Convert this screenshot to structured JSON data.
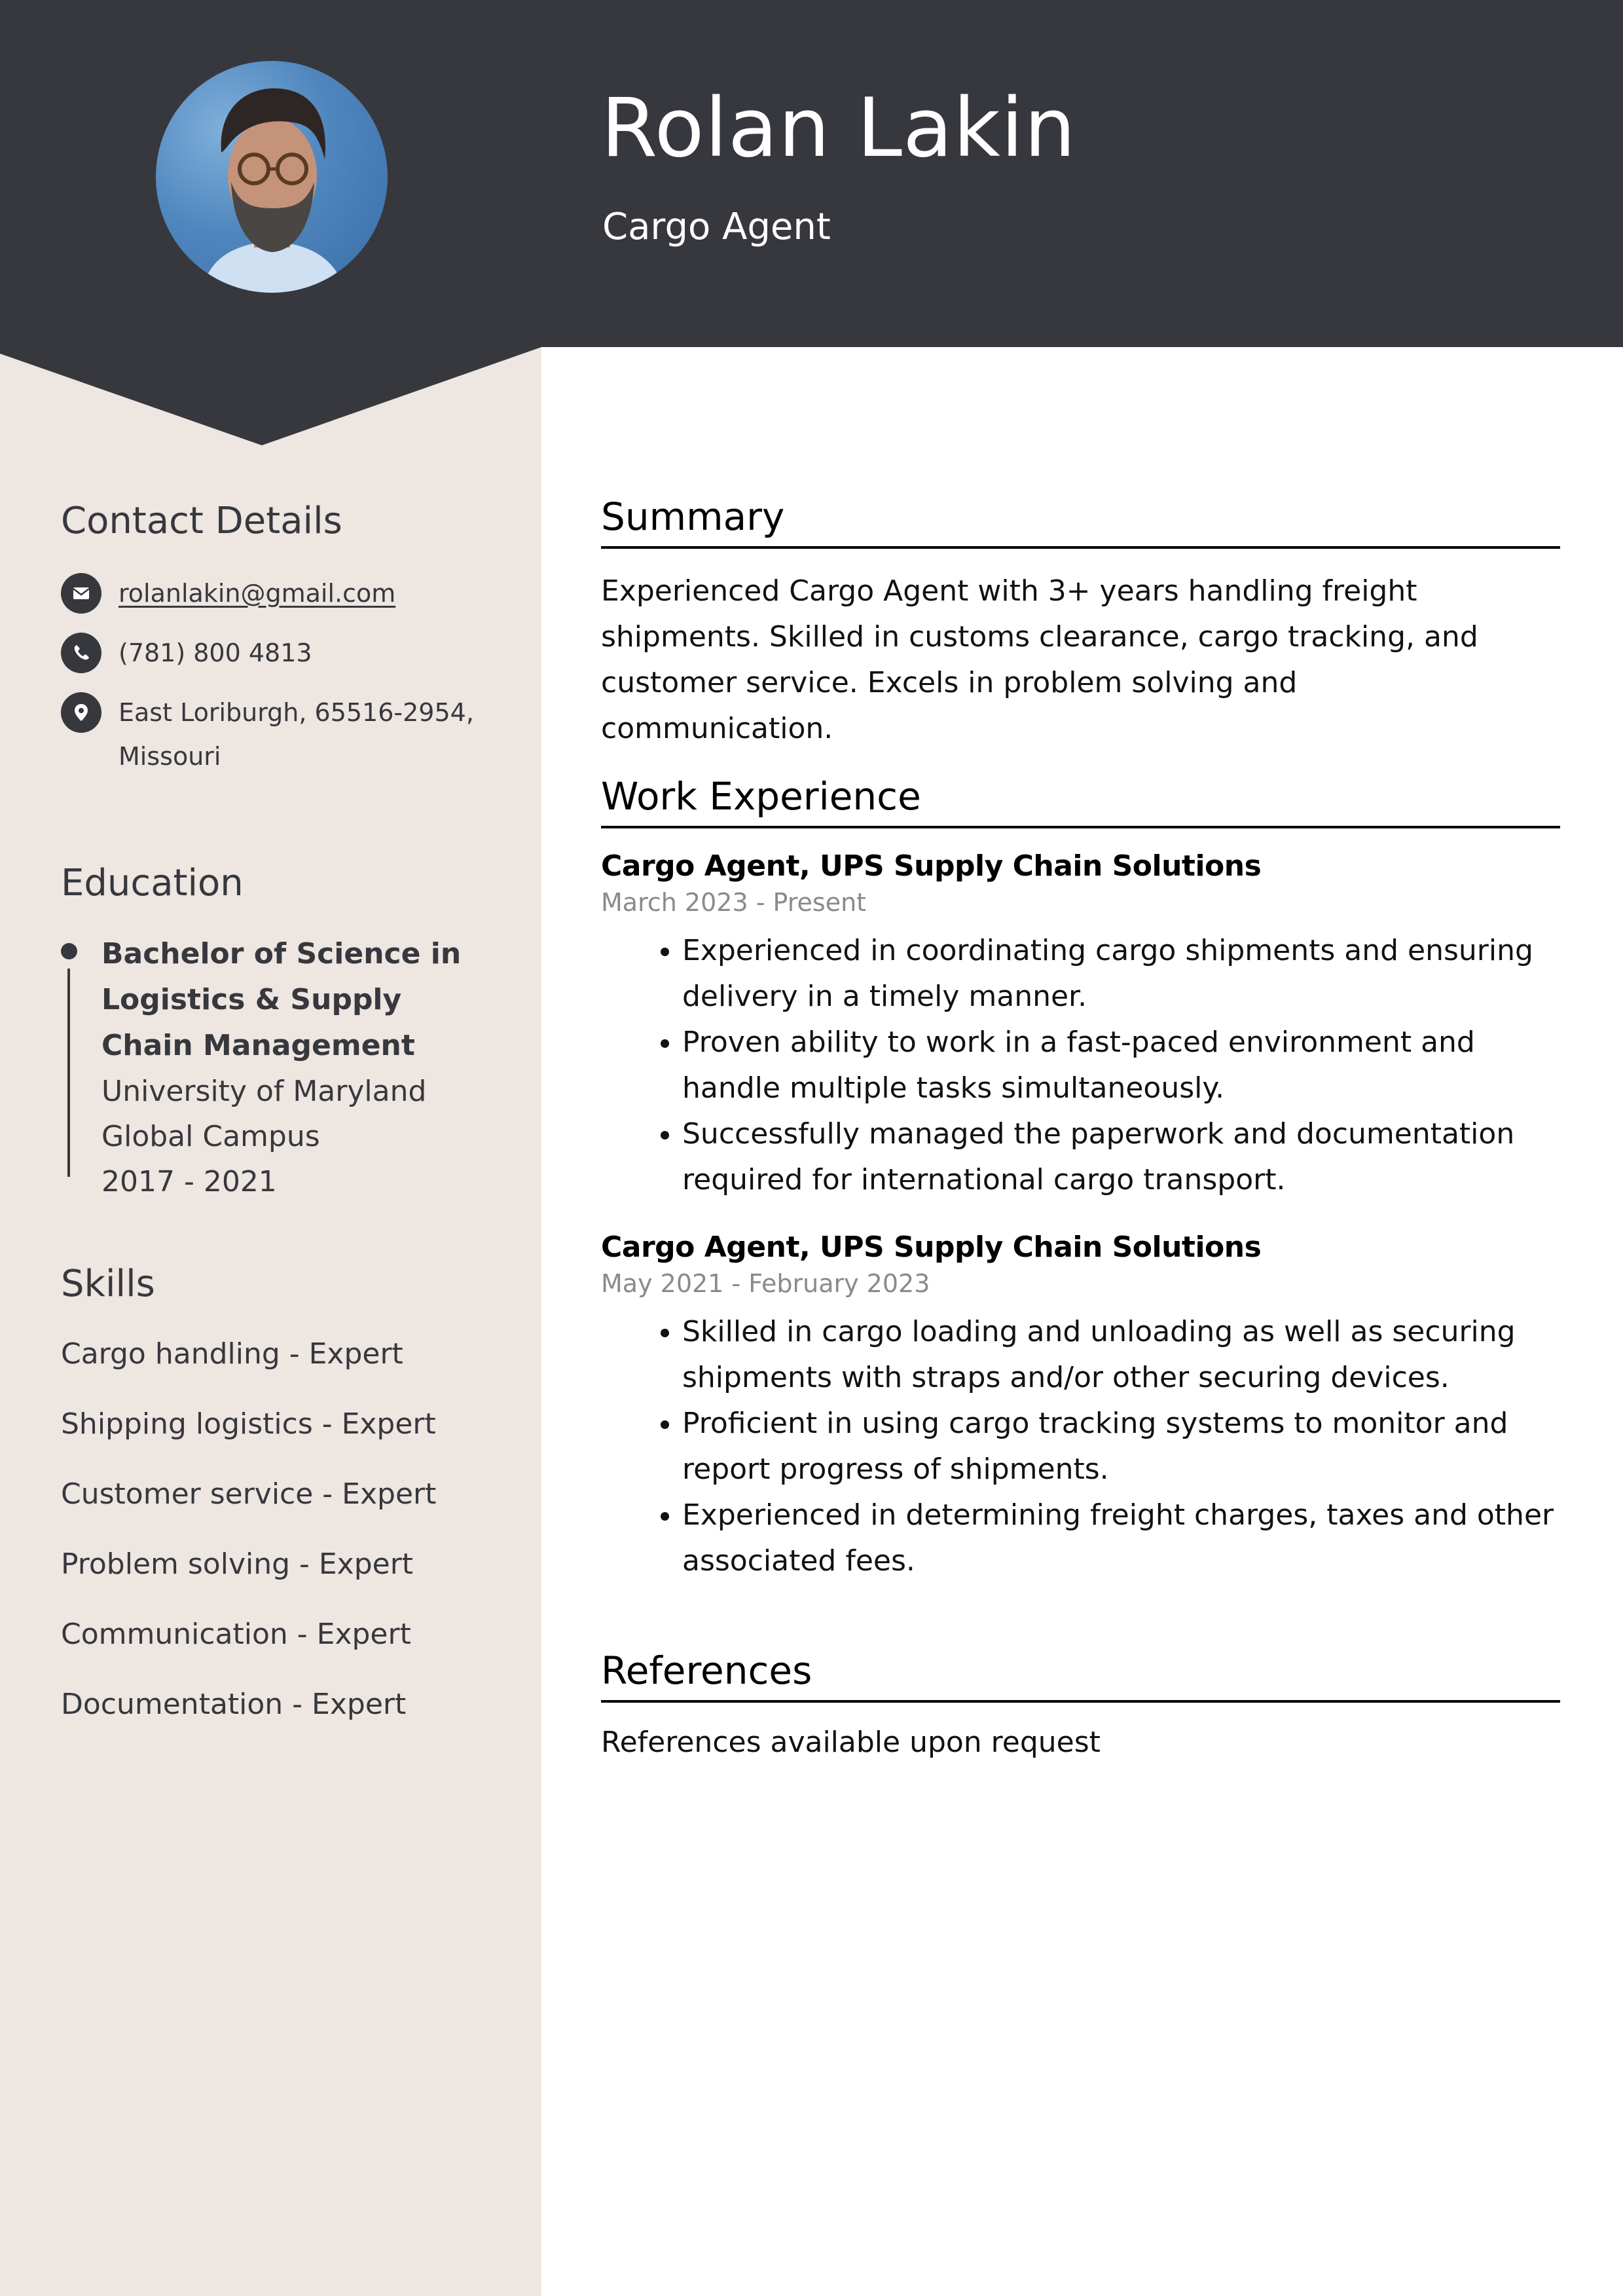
{
  "header": {
    "name": "Rolan Lakin",
    "title": "Cargo Agent",
    "photo_icon": "profile-photo"
  },
  "colors": {
    "header_bg": "#37383e",
    "sidebar_bg": "#ede6e1",
    "text_dark": "#37383e",
    "date_gray": "#8a8a8a"
  },
  "sidebar": {
    "contact": {
      "heading": "Contact Details",
      "email": "rolanlakin@gmail.com",
      "email_icon": "envelope-icon",
      "phone": "(781) 800 4813",
      "phone_icon": "phone-icon",
      "address_line1": "East Loriburgh, 65516-2954,",
      "address_line2": "Missouri",
      "address_icon": "map-pin-icon"
    },
    "education": {
      "heading": "Education",
      "items": [
        {
          "degree": "Bachelor of Science in Logistics & Supply Chain Management",
          "school": "University of Maryland Global Campus",
          "years": "2017 - 2021"
        }
      ]
    },
    "skills": {
      "heading": "Skills",
      "items": [
        "Cargo handling - Expert",
        "Shipping logistics - Expert",
        "Customer service - Expert",
        "Problem solving - Expert",
        "Communication - Expert",
        "Documentation - Expert"
      ]
    }
  },
  "main": {
    "summary": {
      "heading": "Summary",
      "text": "Experienced Cargo Agent with 3+ years handling freight shipments. Skilled in customs clearance, cargo tracking, and customer service. Excels in problem solving and communication."
    },
    "work": {
      "heading": "Work Experience",
      "jobs": [
        {
          "title": "Cargo Agent, UPS Supply Chain Solutions",
          "dates": "March 2023 - Present",
          "bullets": [
            "Experienced in coordinating cargo shipments and ensuring delivery in a timely manner.",
            "Proven ability to work in a fast-paced environment and handle multiple tasks simultaneously.",
            "Successfully managed the paperwork and documentation required for international cargo transport."
          ]
        },
        {
          "title": "Cargo Agent, UPS Supply Chain Solutions",
          "dates": "May 2021 - February 2023",
          "bullets": [
            "Skilled in cargo loading and unloading as well as securing shipments with straps and/or other securing devices.",
            "Proficient in using cargo tracking systems to monitor and report progress of shipments.",
            "Experienced in determining freight charges, taxes and other associated fees."
          ]
        }
      ]
    },
    "references": {
      "heading": "References",
      "text": "References available upon request"
    }
  }
}
